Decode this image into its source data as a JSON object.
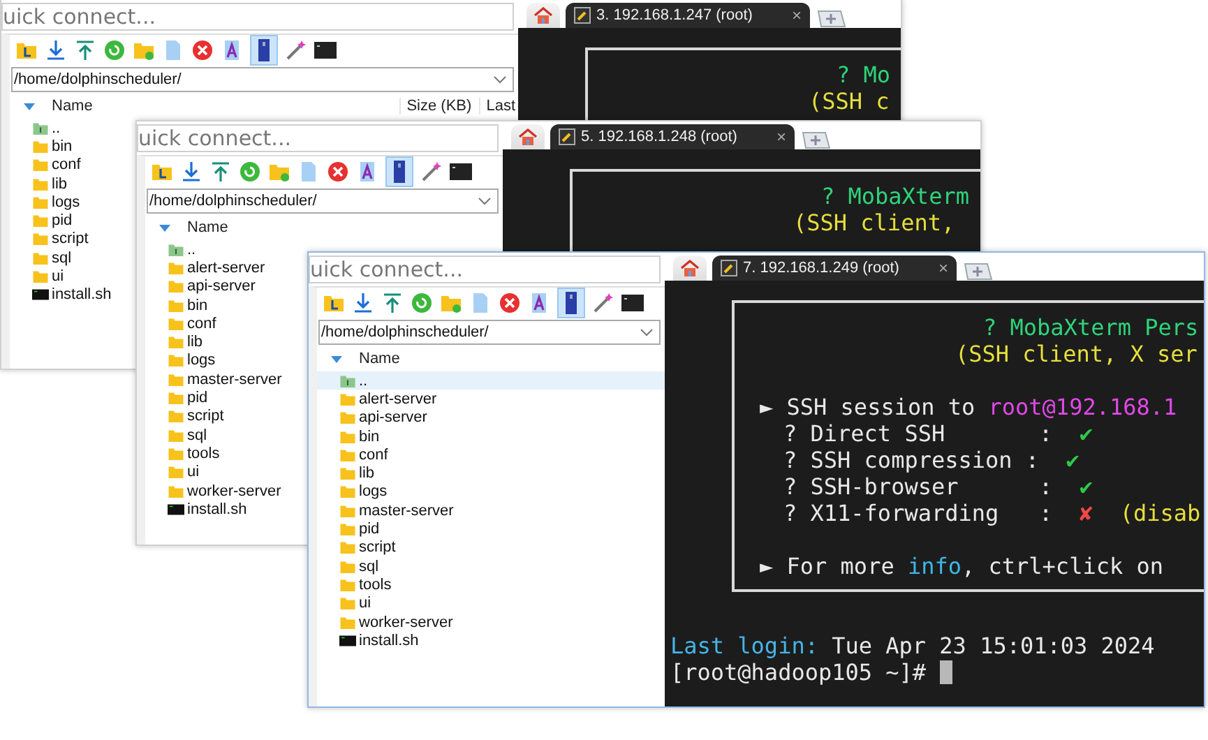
{
  "windows": [
    {
      "browser": {
        "placeholder": "uick connect...",
        "toggle_on": true,
        "path": "/home/dolphinscheduler/",
        "columns": [
          "Name",
          "Size (KB)",
          "Last"
        ],
        "rows": [
          {
            "name": "..",
            "kind": "parent",
            "selected": false
          },
          {
            "name": "bin",
            "kind": "folder",
            "selected": false
          },
          {
            "name": "conf",
            "kind": "folder",
            "selected": false
          },
          {
            "name": "lib",
            "kind": "folder",
            "selected": false
          },
          {
            "name": "logs",
            "kind": "folder",
            "selected": false
          },
          {
            "name": "pid",
            "kind": "folder",
            "selected": false
          },
          {
            "name": "script",
            "kind": "folder",
            "selected": false
          },
          {
            "name": "sql",
            "kind": "folder",
            "selected": false
          },
          {
            "name": "ui",
            "kind": "folder",
            "selected": false
          },
          {
            "name": "install.sh",
            "kind": "script",
            "selected": false
          }
        ]
      },
      "tabs": [
        {
          "label": "3. 192.168.1.247 (root)",
          "close": "×",
          "selected": true
        }
      ],
      "terminal": {
        "banner": [
          {
            "kind": "title",
            "segments": [
              {
                "kind": "title",
                "text": "? Mo"
              }
            ]
          },
          {
            "kind": "subtitle",
            "segments": [
              {
                "kind": "note",
                "text": "(SSH c"
              }
            ]
          }
        ]
      }
    },
    {
      "browser": {
        "placeholder": "uick connect...",
        "toggle_on": true,
        "path": "/home/dolphinscheduler/",
        "columns": [
          "Name"
        ],
        "rows": [
          {
            "name": "..",
            "kind": "parent",
            "selected": false
          },
          {
            "name": "alert-server",
            "kind": "folder",
            "selected": false
          },
          {
            "name": "api-server",
            "kind": "folder",
            "selected": false
          },
          {
            "name": "bin",
            "kind": "folder",
            "selected": false
          },
          {
            "name": "conf",
            "kind": "folder",
            "selected": false
          },
          {
            "name": "lib",
            "kind": "folder",
            "selected": false
          },
          {
            "name": "logs",
            "kind": "folder",
            "selected": false
          },
          {
            "name": "master-server",
            "kind": "folder",
            "selected": false
          },
          {
            "name": "pid",
            "kind": "folder",
            "selected": false
          },
          {
            "name": "script",
            "kind": "folder",
            "selected": false
          },
          {
            "name": "sql",
            "kind": "folder",
            "selected": false
          },
          {
            "name": "tools",
            "kind": "folder",
            "selected": false
          },
          {
            "name": "ui",
            "kind": "folder",
            "selected": false
          },
          {
            "name": "worker-server",
            "kind": "folder",
            "selected": false
          },
          {
            "name": "install.sh",
            "kind": "script",
            "selected": false
          }
        ]
      },
      "tabs": [
        {
          "label": "5. 192.168.1.248 (root)",
          "close": "×",
          "selected": true
        }
      ],
      "terminal": {
        "banner": [
          {
            "kind": "title",
            "segments": [
              {
                "kind": "title",
                "text": "? MobaXterm"
              }
            ]
          },
          {
            "kind": "subtitle",
            "segments": [
              {
                "kind": "note",
                "text": "(SSH client,"
              }
            ]
          }
        ]
      }
    },
    {
      "browser": {
        "placeholder": "uick connect...",
        "toggle_on": true,
        "path": "/home/dolphinscheduler/",
        "columns": [
          "Name"
        ],
        "rows": [
          {
            "name": "..",
            "kind": "parent",
            "selected": true
          },
          {
            "name": "alert-server",
            "kind": "folder",
            "selected": false
          },
          {
            "name": "api-server",
            "kind": "folder",
            "selected": false
          },
          {
            "name": "bin",
            "kind": "folder",
            "selected": false
          },
          {
            "name": "conf",
            "kind": "folder",
            "selected": false
          },
          {
            "name": "lib",
            "kind": "folder",
            "selected": false
          },
          {
            "name": "logs",
            "kind": "folder",
            "selected": false
          },
          {
            "name": "master-server",
            "kind": "folder",
            "selected": false
          },
          {
            "name": "pid",
            "kind": "folder",
            "selected": false
          },
          {
            "name": "script",
            "kind": "folder",
            "selected": false
          },
          {
            "name": "sql",
            "kind": "folder",
            "selected": false
          },
          {
            "name": "tools",
            "kind": "folder",
            "selected": false
          },
          {
            "name": "ui",
            "kind": "folder",
            "selected": false
          },
          {
            "name": "worker-server",
            "kind": "folder",
            "selected": false
          },
          {
            "name": "install.sh",
            "kind": "script",
            "selected": false
          }
        ]
      },
      "tabs": [
        {
          "label": "7. 192.168.1.249 (root)",
          "close": "×",
          "selected": true
        }
      ],
      "terminal": {
        "banner": [
          {
            "kind": "title",
            "segments": [
              {
                "kind": "title",
                "text": "? MobaXterm Pers"
              }
            ]
          },
          {
            "kind": "subtitle",
            "segments": [
              {
                "kind": "note",
                "text": "(SSH client, X ser"
              }
            ]
          },
          {
            "kind": "section",
            "segments": [
              {
                "kind": "plain",
                "text": "► SSH session to "
              },
              {
                "kind": "host",
                "text": "root@192.168.1"
              }
            ]
          },
          {
            "kind": "item",
            "segments": [
              {
                "kind": "plain",
                "text": "? Direct SSH       :  "
              },
              {
                "kind": "ok",
                "text": "✔"
              }
            ]
          },
          {
            "kind": "item",
            "segments": [
              {
                "kind": "plain",
                "text": "? SSH compression :  "
              },
              {
                "kind": "ok",
                "text": "✔"
              }
            ]
          },
          {
            "kind": "item",
            "segments": [
              {
                "kind": "plain",
                "text": "? SSH-browser      :  "
              },
              {
                "kind": "ok",
                "text": "✔"
              }
            ]
          },
          {
            "kind": "item",
            "segments": [
              {
                "kind": "plain",
                "text": "? X11-forwarding   :  "
              },
              {
                "kind": "fail",
                "text": "✘"
              },
              {
                "kind": "note",
                "text": "  (disab"
              }
            ]
          },
          {
            "kind": "section",
            "segments": [
              {
                "kind": "plain",
                "text": "► For more "
              },
              {
                "kind": "link",
                "text": "info"
              },
              {
                "kind": "plain",
                "text": ", ctrl+click on"
              }
            ]
          }
        ],
        "output": [
          {
            "kind": "first",
            "segments": [
              {
                "kind": "label",
                "text": "Last login:"
              },
              {
                "kind": "plain",
                "text": " Tue Apr 23 15:01:03 2024"
              }
            ]
          },
          {
            "kind": "prompt",
            "segments": [
              {
                "kind": "plain",
                "text": "[root@hadoop105 ~]# "
              }
            ]
          }
        ]
      }
    }
  ]
}
